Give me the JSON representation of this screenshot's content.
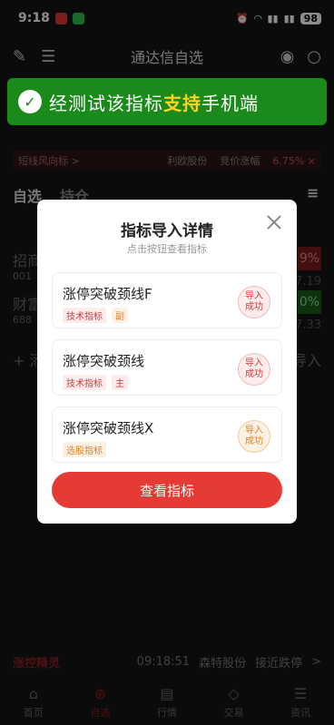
{
  "status_bar": {
    "time": "9:18",
    "battery": "98"
  },
  "navbar": {
    "title": "通达信自选"
  },
  "banner": {
    "prefix": "经测试该指标",
    "highlight": "支持",
    "suffix": "手机端"
  },
  "ticker": {
    "label": "短线风向标 >",
    "stock": "利欧股份",
    "change_label": "竞价涨幅",
    "pct": "6.75% ×"
  },
  "tabs": {
    "self_select": "自选",
    "holdings": "持仓"
  },
  "bg_rows": [
    {
      "name": "招商",
      "code": "001",
      "pct": "9%",
      "price": "7.19"
    },
    {
      "name": "财富",
      "code": "688",
      "pct": "0%",
      "price": "7.33"
    }
  ],
  "bg_add": "+ 添",
  "bg_import": "导入",
  "dialog": {
    "title": "指标导入详情",
    "subtitle": "点击按钮查看指标",
    "items": [
      {
        "name": "涨停突破颈线F",
        "tag1": "技术指标",
        "tag2": "副",
        "stamp": "导入\n成功",
        "tone": "red"
      },
      {
        "name": "涨停突破颈线",
        "tag1": "技术指标",
        "tag2": "主",
        "stamp": "导入\n成功",
        "tone": "red"
      },
      {
        "name": "涨停突破颈线X",
        "tag1": "选股指标",
        "tag2": "",
        "stamp": "导入\n成功",
        "tone": "orange"
      }
    ],
    "view_button": "查看指标"
  },
  "bottom_ticker": {
    "brand": "涨控精灵",
    "time": "09:18:51",
    "stock": "森特股份",
    "event": "接近跌停",
    "arrow": ">"
  },
  "tabbar": [
    "首页",
    "自选",
    "行情",
    "交易",
    "资讯"
  ]
}
